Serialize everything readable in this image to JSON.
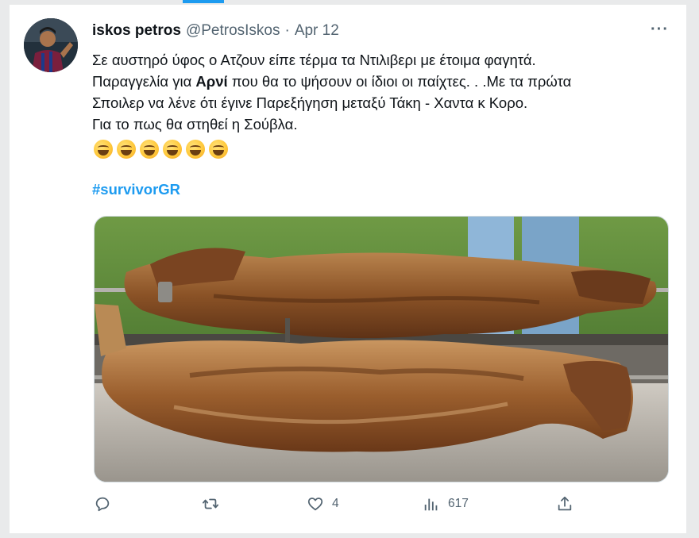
{
  "tweet": {
    "display_name": "iskos petros",
    "handle": "@PetrosIskos",
    "separator": "·",
    "date": "Apr 12",
    "more_label": "···",
    "text_lines": [
      {
        "pre": "Σε αυστηρό ύφος ο Ατζουν είπε τέρμα τα Ντιλιβερι με έτοιμα φαγητά.",
        "bold": "",
        "post": ""
      },
      {
        "pre": "Παραγγελία για ",
        "bold": "Αρνί",
        "post": " που θα το ψήσουν οι ίδιοι οι παίχτες. . .Με τα πρώτα"
      },
      {
        "pre": "Σποιλερ να λένε ότι έγινε Παρεξήγηση μεταξύ Τάκη - Χαντα κ Κορο.",
        "bold": "",
        "post": ""
      },
      {
        "pre": "Για το πως θα στηθεί η Σούβλα.",
        "bold": "",
        "post": ""
      }
    ],
    "emojis": [
      "laughing-tears",
      "laughing-tears",
      "laughing-tears",
      "sweat-smile",
      "sweat-smile",
      "sweat-smile"
    ],
    "hashtag": "#survivorGR",
    "media_description_icon": "spit-roast-lamb-photo"
  },
  "actions": {
    "reply_count": "",
    "retweet_count": "",
    "like_count": "4",
    "views_count": "617",
    "share_count": ""
  },
  "colors": {
    "accent": "#1d9bf0",
    "text_primary": "#0f1419",
    "text_secondary": "#536471"
  }
}
